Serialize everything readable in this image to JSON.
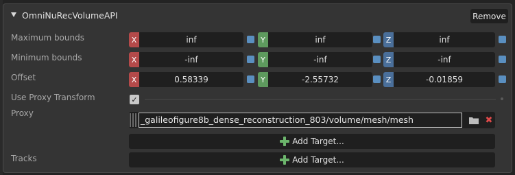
{
  "header": {
    "title": "OmniNuRecVolumeAPI",
    "remove_label": "Remove"
  },
  "rows": {
    "max_bounds": {
      "label": "Maximum bounds",
      "x": "inf",
      "y": "inf",
      "z": "inf"
    },
    "min_bounds": {
      "label": "Minimum bounds",
      "x": "-inf",
      "y": "-inf",
      "z": "-inf"
    },
    "offset": {
      "label": "Offset",
      "x": "0.58339",
      "y": "-2.55732",
      "z": "-0.01859"
    },
    "use_proxy": {
      "label": "Use Proxy Transform",
      "checked": true,
      "check_glyph": "✓"
    },
    "proxy": {
      "label": "Proxy",
      "path": "_galileofigure8b_dense_reconstruction_803/volume/mesh/mesh",
      "clear_glyph": "✖",
      "add_target_label": "Add Target..."
    },
    "tracks": {
      "label": "Tracks",
      "add_target_label": "Add Target..."
    }
  },
  "axes": {
    "x": "X",
    "y": "Y",
    "z": "Z"
  },
  "colors": {
    "axis_x": "#b44a4a",
    "axis_y": "#5e9a5e",
    "axis_z": "#4a6f9a",
    "accent_blue": "#5a8fc0",
    "plus_green": "#6cb56c",
    "clear_red": "#e04a4a"
  }
}
